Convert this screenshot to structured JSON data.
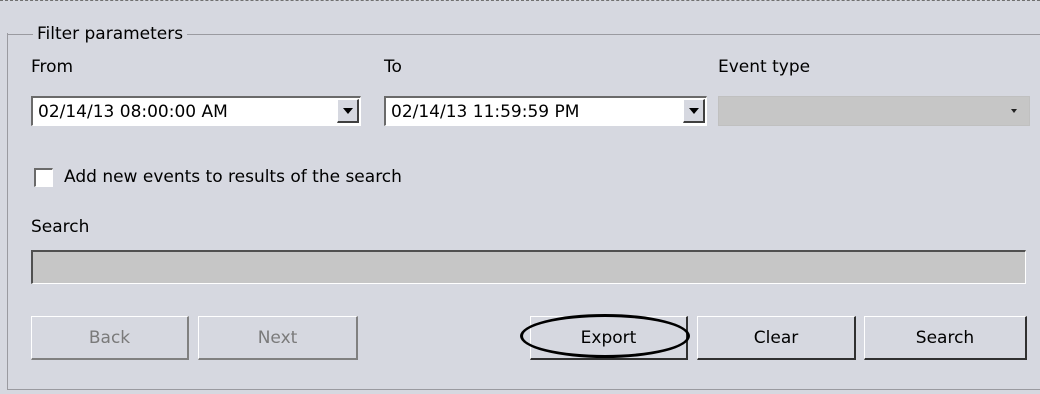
{
  "filter": {
    "group_title": "Filter parameters",
    "from_label": "From",
    "to_label": "To",
    "event_type_label": "Event type",
    "from_value": "02/14/13 08:00:00 AM",
    "to_value": "02/14/13 11:59:59 PM",
    "event_type_value": "",
    "add_new_events_label": "Add new events to results of the search",
    "add_new_events_checked": false,
    "search_label": "Search",
    "search_value": ""
  },
  "buttons": {
    "back": "Back",
    "next": "Next",
    "export": "Export",
    "clear": "Clear",
    "search": "Search"
  },
  "annotation": {
    "highlighted_button": "Export"
  }
}
